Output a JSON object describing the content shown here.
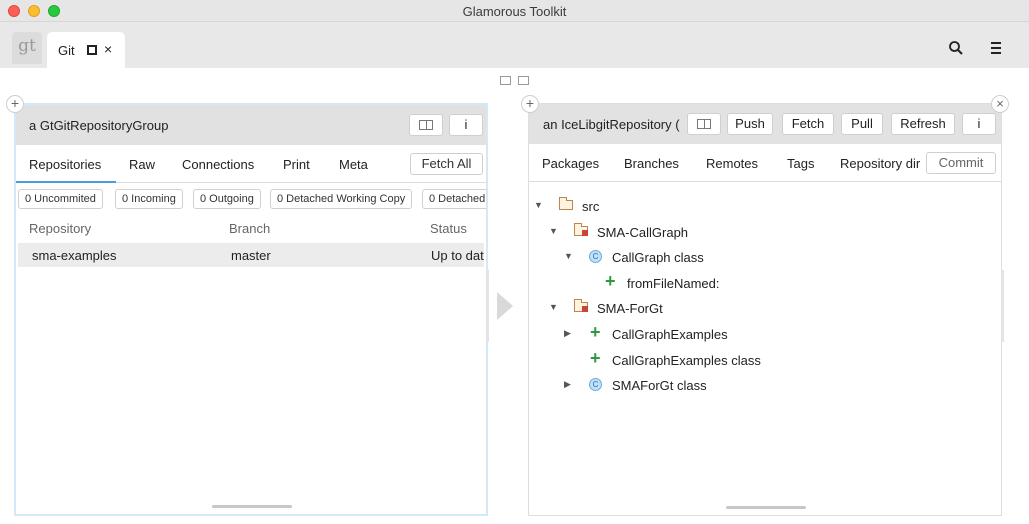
{
  "window": {
    "title": "Glamorous Toolkit"
  },
  "tabbar": {
    "logo": "gt",
    "tab_label": "Git",
    "tab_close": "×"
  },
  "left_pane": {
    "title": "a GtGitRepositoryGroup",
    "info_button": "i",
    "tabs": [
      "Repositories",
      "Raw",
      "Connections",
      "Print",
      "Meta"
    ],
    "fetch_all": "Fetch All",
    "badges": [
      "0 Uncommited",
      "0 Incoming",
      "0 Outgoing",
      "0 Detached Working Copy",
      "0 Detached"
    ],
    "columns": {
      "repository": "Repository",
      "branch": "Branch",
      "status": "Status"
    },
    "rows": [
      {
        "repository": "sma-examples",
        "branch": "master",
        "status": "Up to dat"
      }
    ]
  },
  "right_pane": {
    "title": "an IceLibgitRepository (",
    "buttons": {
      "push": "Push",
      "fetch": "Fetch",
      "pull": "Pull",
      "refresh": "Refresh",
      "info": "i"
    },
    "tabs": [
      "Packages",
      "Branches",
      "Remotes",
      "Tags",
      "Repository dir"
    ],
    "commit": "Commit",
    "tree": [
      {
        "label": "src",
        "icon": "folder-icon",
        "expander": "expanded"
      },
      {
        "label": "SMA-CallGraph",
        "icon": "package-icon",
        "expander": "expanded"
      },
      {
        "label": "CallGraph class",
        "icon": "class-icon",
        "expander": "expanded"
      },
      {
        "label": "fromFileNamed:",
        "icon": "plus-icon",
        "expander": "none"
      },
      {
        "label": "SMA-ForGt",
        "icon": "package-icon",
        "expander": "expanded"
      },
      {
        "label": "CallGraphExamples",
        "icon": "plus-icon",
        "expander": "collapsed"
      },
      {
        "label": "CallGraphExamples class",
        "icon": "plus-icon",
        "expander": "none"
      },
      {
        "label": "SMAForGt class",
        "icon": "class-icon",
        "expander": "collapsed"
      }
    ]
  },
  "glyphs": {
    "expanded": "▼",
    "collapsed": "▶",
    "plus": "+",
    "class": "C",
    "pane_add": "+",
    "pane_close": "×"
  }
}
